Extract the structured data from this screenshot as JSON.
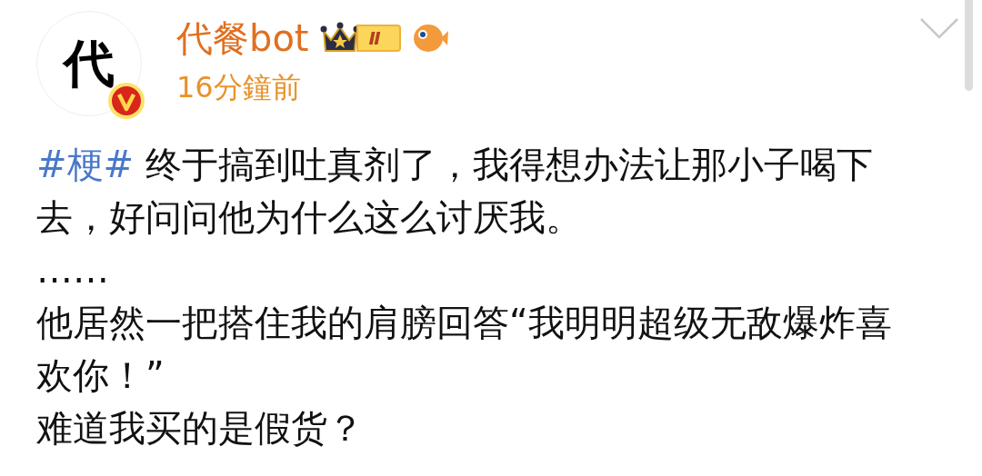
{
  "author": {
    "avatar_text": "代",
    "verified": true,
    "name": "代餐bot",
    "level_badge": "Ⅱ",
    "time": "16分鐘前"
  },
  "post": {
    "hashtag": "#梗#",
    "lines": [
      "终于搞到吐真剂了，我得想办法让那小子喝下去，好问问他为什么这么讨厌我。",
      "……",
      "他居然一把搭住我的肩膀回答“我明明超级无敌爆炸喜欢你！”",
      "难道我买的是假货？"
    ]
  }
}
